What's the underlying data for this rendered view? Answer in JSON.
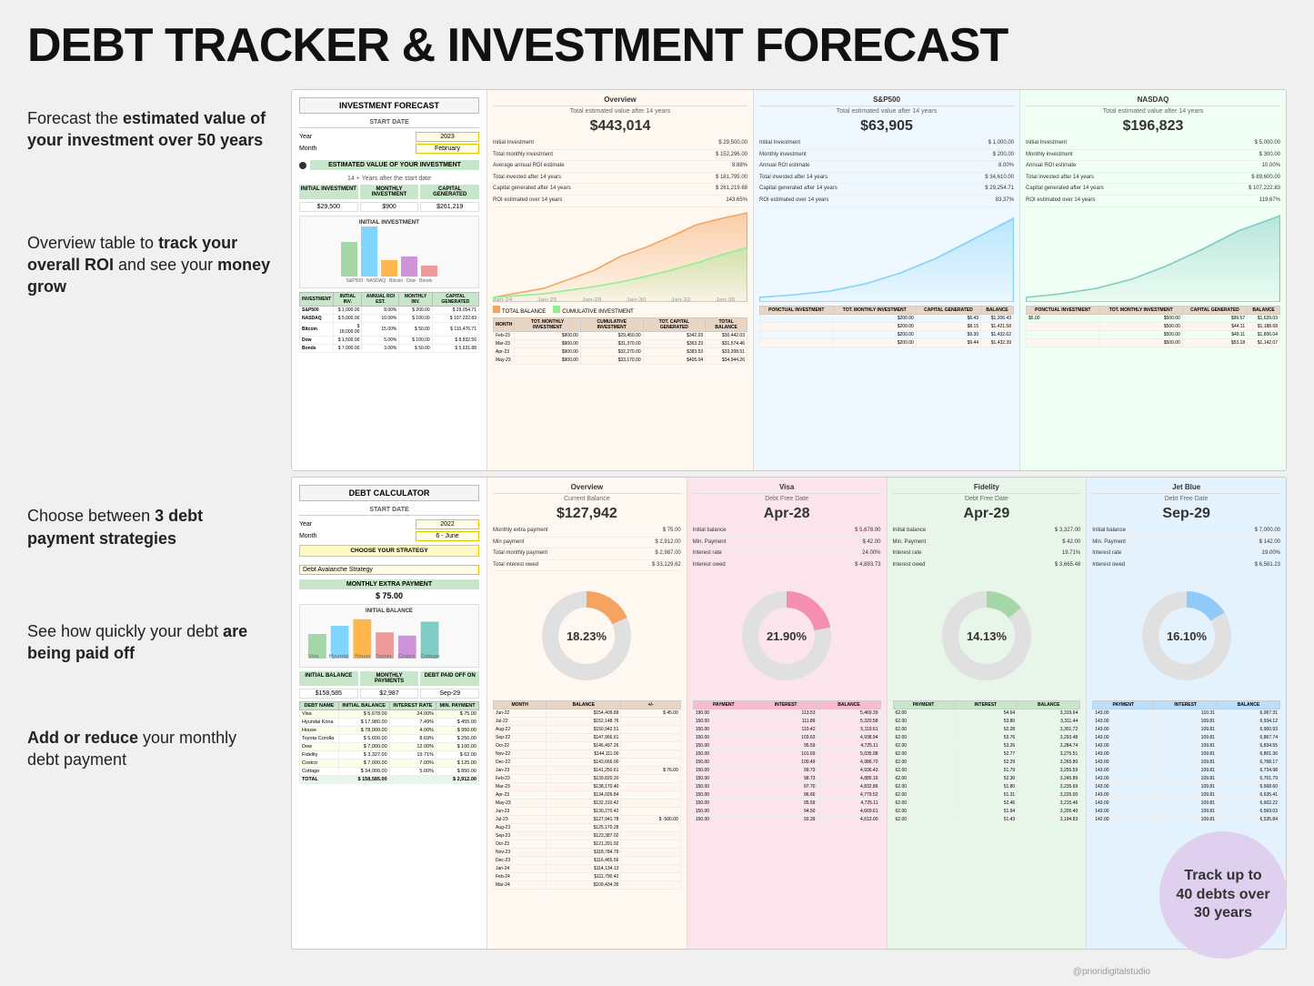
{
  "title": "DEBT TRACKER & INVESTMENT FORECAST",
  "investment": {
    "section_title": "INVESTMENT FORECAST",
    "start_date_label": "START DATE",
    "year_label": "Year",
    "month_label": "Month",
    "year_value": "2023",
    "month_value": "February",
    "estimated_label": "ESTIMATED VALUE OF YOUR INVESTMENT",
    "years_after": "14 + Years after the start date",
    "initial_investment_label": "INITIAL INVESTMENT",
    "monthly_investment_label": "MONTHLY INVESTMENT",
    "capital_generated_label": "CAPITAL GENERATED",
    "initial_value": "$29,500",
    "monthly_value": "$900",
    "capital_value": "$261,219",
    "chart_title": "INITIAL INVESTMENT",
    "chart_labels": [
      "S&P500",
      "NASDAQ",
      "Bitcoin",
      "Dow",
      "Bonds"
    ],
    "table_headers": [
      "INVESTMENT",
      "INITIAL INVESTMENT",
      "ANNUAL ROI EST.",
      "MONTHLY INVESTMENT",
      "CAPITAL GENERATED"
    ],
    "table_rows": [
      [
        "S&P500",
        "$ 1,000.00",
        "8.00%",
        "$ 200.00",
        "$ 29,054.71"
      ],
      [
        "NASDAQ",
        "$ 5,000.00",
        "10.00%",
        "$ 100.00",
        "$ 107,222.83"
      ],
      [
        "Bitcoin",
        "$ 18,000.00",
        "15.00%",
        "$ 50.00",
        "$ 110,476.71"
      ],
      [
        "Dow",
        "$ 1,500.00",
        "5.00%",
        "$ 100.00",
        "$ 8,832.56"
      ],
      [
        "Bonds",
        "$ 7,000.00",
        "3.00%",
        "$ 50.00",
        "$ 5,631.88"
      ]
    ]
  },
  "overview_inv": {
    "title": "Overview",
    "subtitle": "Total estimated value after 14 years",
    "big_value": "$443,014",
    "stats": [
      [
        "Initial Investment",
        "$ 29,500.00"
      ],
      [
        "Total monthly investment",
        "$ 152,296.00"
      ],
      [
        "Average annual ROI estimate",
        "8.88%"
      ],
      [
        "Total invested after 14 years",
        "$ 181,795.00"
      ],
      [
        "Capital generated after 14 years",
        "$ 261,219.68"
      ],
      [
        "ROI estimated over 14 years",
        "143.65%"
      ]
    ],
    "chart_labels": [
      "Jan-24",
      "Jan-25",
      "Jan-28",
      "Jan-30",
      "Jan-32",
      "Jan-35"
    ],
    "legend": [
      "TOTAL BALANCE",
      "CUMULATIVE INVESTMENT"
    ],
    "table_headers": [
      "MONTH",
      "TOT. MONTHLY INVESTMENT",
      "CUMULATIVE INVESTMENT",
      "TOT. CAPITAL GENERATED",
      "TOTAL BALANCE"
    ],
    "table_rows": [
      [
        "Feb-23",
        "$900.00",
        "$29,450.00",
        "$342.03",
        "$30,442.03"
      ],
      [
        "Mar-23",
        "$900.00",
        "$31,370.00",
        "$363.23",
        "$31,574.46"
      ],
      [
        "Apr-23",
        "$900.00",
        "$32,270.00",
        "$383.53",
        "$33,208.51"
      ],
      [
        "May-23",
        "$900.00",
        "$33,170.00",
        "$405.04",
        "$34,944.26"
      ]
    ]
  },
  "sp500": {
    "title": "S&P500",
    "subtitle": "Total estimated value after 14 years",
    "big_value": "$63,905",
    "stats": [
      [
        "Initial Investment",
        "$ 1,000.00"
      ],
      [
        "Monthly investment",
        "$ 200.00"
      ],
      [
        "Annual ROI estimate",
        "8.00%"
      ],
      [
        "Total invested after 14 years",
        "$ 34,610.00"
      ],
      [
        "Capital generated after 14 years",
        "$ 29,254.71"
      ],
      [
        "ROI estimated over 14 years",
        "83.37%"
      ]
    ],
    "table_headers": [
      "PONCTUAL INVESTMENT",
      "TOT. MONTHLY INVESTMENT",
      "CAPITAL GENERATED",
      "BALANCE"
    ],
    "table_rows": [
      [
        "",
        "$200.00",
        "$6.43",
        "$1,206.43"
      ],
      [
        "",
        "$200.00",
        "$8.15",
        "$1,421.58"
      ],
      [
        "",
        "$200.00",
        "$9.30",
        "$1,432.62"
      ],
      [
        "",
        "$200.00",
        "$9.44",
        "$1,432.39"
      ]
    ]
  },
  "nasdaq": {
    "title": "NASDAQ",
    "subtitle": "Total estimated value after 14 years",
    "big_value": "$196,823",
    "stats": [
      [
        "Initial Investment",
        "$ 5,000.00"
      ],
      [
        "Monthly investment",
        "$ 300.00"
      ],
      [
        "Annual ROI estimate",
        "10.00%"
      ],
      [
        "Total invested after 14 years",
        "$ 89,600.00"
      ],
      [
        "Capital generated after 14 years",
        "$ 107,222.83"
      ],
      [
        "ROI estimated over 14 years",
        "119.67%"
      ]
    ],
    "table_headers": [
      "PONCTUAL INVESTMENT",
      "TOT. MONTHLY INVESTMENT",
      "CAPITAL GENERATED",
      "BALANCE"
    ],
    "table_rows": [
      [
        "$5.00",
        "$500.00",
        "$99.57",
        "$1,639.03"
      ],
      [
        "",
        "$500.00",
        "$44.11",
        "$1,188.68"
      ],
      [
        "",
        "$500.00",
        "$49.11",
        "$1,806.04"
      ],
      [
        "",
        "$500.00",
        "$53.18",
        "$1,142.07"
      ]
    ]
  },
  "debt": {
    "section_title": "DEBT CALCULATOR",
    "start_date_label": "START DATE",
    "year_label": "Year",
    "month_label": "Month",
    "year_value": "2022",
    "month_value": "6 - June",
    "strategy_label": "CHOOSE YOUR STRATEGY",
    "strategy_value": "Debt Avalanche Strategy",
    "extra_payment_label": "MONTHLY EXTRA PAYMENT",
    "extra_payment_value": "$ 75.00",
    "chart_title": "INITIAL BALANCE",
    "chart_labels": [
      "Visa",
      "Hyundai",
      "House",
      "Toyota",
      "Costco",
      "Cottage"
    ],
    "summary_labels": [
      "INITIAL BALANCE",
      "MONTHLY PAYMENTS",
      "DEBT PAID OFF ON"
    ],
    "summary_values": [
      "$158,585",
      "$2,987",
      "Sep-29"
    ],
    "table_headers": [
      "DEBT NAME",
      "INITIAL BALANCE",
      "INTEREST RATE",
      "MIN. PAYMENT"
    ],
    "table_rows": [
      [
        "Visa",
        "$ 5,678.00",
        "24.00%",
        "$ 75.00"
      ],
      [
        "Hyundai Kona",
        "$ 17,980.00",
        "7.49%",
        "$ 455.00"
      ],
      [
        "House",
        "$ 78,000.00",
        "4.00%",
        "$ 950.00"
      ],
      [
        "Toyota Corolla",
        "$ 5,600.00",
        "8.69%",
        "$ 250.00"
      ],
      [
        "Dow",
        "$ 7,000.00",
        "12.00%",
        "$ 100.00"
      ],
      [
        "Fidelity",
        "$ 3,327.00",
        "19.71%",
        "$ 62.00"
      ],
      [
        "Costco",
        "$ 7,000.00",
        "7.00%",
        "$ 125.00"
      ],
      [
        "Cottage",
        "$ 34,000.00",
        "5.00%",
        "$ 850.00"
      ]
    ],
    "total_row": [
      "TOTAL",
      "$ 158,585.00",
      "",
      "$ 2,912.00"
    ]
  },
  "overview_debt": {
    "title": "Overview",
    "subtitle": "Current Balance",
    "big_value": "$127,942",
    "stats": [
      [
        "Monthly extra payment",
        "$ 75.00"
      ],
      [
        "Min payment",
        "$ 2,912.00"
      ],
      [
        "Total monthly payment",
        "$ 2,987.00"
      ],
      [
        "Total interest owed",
        "$ 33,129.62"
      ]
    ],
    "donut_percent": "18.23%",
    "table_headers": [
      "MONTH",
      "BALANCE",
      "+/-"
    ],
    "table_rows": [
      [
        "Jun-22",
        "$154,409.89",
        "$ 45.00"
      ],
      [
        "Jul-22",
        "$152,148.76",
        ""
      ],
      [
        "Aug-22",
        "$150,942.51",
        ""
      ],
      [
        "Sep-22",
        "$147,966.61",
        ""
      ],
      [
        "Oct-22",
        "$146,497.26",
        ""
      ],
      [
        "Nov-22",
        "$144,111.00",
        ""
      ],
      [
        "Dec-22",
        "$143,666.00",
        ""
      ],
      [
        "Jan-23",
        "$141,250.61",
        "$ 76.00"
      ],
      [
        "Feb-23",
        "$139,820.20",
        ""
      ],
      [
        "Mar-23",
        "$138,170.40",
        ""
      ],
      [
        "Apr-23",
        "$134,026.84",
        ""
      ],
      [
        "May-23",
        "$132,310.42",
        ""
      ],
      [
        "Jun-23",
        "$130,270.42",
        ""
      ],
      [
        "Jul-23",
        "$127,941.78",
        "$ -500.00"
      ],
      [
        "Aug-23",
        "$125,170.28",
        ""
      ],
      [
        "Sep-23",
        "$123,387.02",
        ""
      ],
      [
        "Oct-23",
        "$121,291.92",
        ""
      ],
      [
        "Nov-23",
        "$118,784.79",
        ""
      ],
      [
        "Dec-23",
        "$116,465.56",
        ""
      ],
      [
        "Jan-24",
        "$114,134.13",
        ""
      ],
      [
        "Feb-24",
        "$111,790.42",
        ""
      ],
      [
        "Mar-24",
        "$109,434.35",
        ""
      ]
    ]
  },
  "visa_debt": {
    "title": "Visa",
    "subtitle": "Debt Free Date",
    "free_date": "Apr-28",
    "stats": [
      [
        "Initial balance",
        "$ 5,678.00"
      ],
      [
        "Min. Payment",
        "$ 42.00"
      ],
      [
        "Interest rate",
        "24.00%"
      ],
      [
        "Interest owed",
        "$ 4,893.73"
      ]
    ],
    "donut_percent": "21.90%",
    "table_headers": [
      "PAYMENT",
      "INTEREST",
      "BALANCE"
    ],
    "table_rows": [
      [
        "190.00",
        "113.53",
        "5,469.39"
      ],
      [
        "150.00",
        "111.89",
        "5,320.58"
      ],
      [
        "150.00",
        "110.42",
        "5,119.61"
      ],
      [
        "150.00",
        "103.63",
        "4,938.94"
      ],
      [
        "150.00",
        "95.59",
        "4,725.11"
      ],
      [
        "150.00",
        "101.69",
        "5,035.98"
      ],
      [
        "150.00",
        "100.49",
        "4,986.70"
      ],
      [
        "150.00",
        "99.73",
        "4,936.43"
      ],
      [
        "150.00",
        "98.73",
        "4,885.16"
      ],
      [
        "150.00",
        "97.70",
        "4,832.86"
      ],
      [
        "150.00",
        "96.66",
        "4,779.52"
      ],
      [
        "150.00",
        "95.59",
        "4,725.11"
      ],
      [
        "150.00",
        "94.50",
        "4,669.61"
      ],
      [
        "150.00",
        "93.39",
        "4,613.00"
      ]
    ]
  },
  "fidelity_debt": {
    "title": "Fidelity",
    "subtitle": "Debt Free Date",
    "free_date": "Apr-29",
    "stats": [
      [
        "Initial balance",
        "$ 3,327.00"
      ],
      [
        "Min. Payment",
        "$ 42.00"
      ],
      [
        "Interest rate",
        "19.71%"
      ],
      [
        "Interest owed",
        "$ 3,665.48"
      ]
    ],
    "donut_percent": "14.13%",
    "table_headers": [
      "PAYMENT",
      "INTEREST",
      "BALANCE"
    ],
    "table_rows": [
      [
        "62.00",
        "54.64",
        "3,319.64"
      ],
      [
        "62.00",
        "53.80",
        "3,311.44"
      ],
      [
        "62.00",
        "52.28",
        "3,301.72"
      ],
      [
        "62.00",
        "53.76",
        "3,293.48"
      ],
      [
        "62.00",
        "53.26",
        "3,284.74"
      ],
      [
        "62.00",
        "52.77",
        "3,275.51"
      ],
      [
        "62.00",
        "52.29",
        "3,265.80"
      ],
      [
        "62.00",
        "51.79",
        "3,255.59"
      ],
      [
        "62.00",
        "52.30",
        "3,245.89"
      ],
      [
        "62.00",
        "51.80",
        "3,235.69"
      ],
      [
        "62.00",
        "51.31",
        "3,225.00"
      ],
      [
        "62.00",
        "52.46",
        "3,215.46"
      ],
      [
        "62.00",
        "51.94",
        "3,205.40"
      ],
      [
        "62.00",
        "51.43",
        "3,194.83"
      ]
    ]
  },
  "jetblue_debt": {
    "title": "Jet Blue",
    "subtitle": "Debt Free Date",
    "free_date": "Sep-29",
    "stats": [
      [
        "Initial balance",
        "$ 7,000.00"
      ],
      [
        "Min. Payment",
        "$ 142.00"
      ],
      [
        "Interest rate",
        "19.00%"
      ],
      [
        "Interest owed",
        "$ 6,581.23"
      ]
    ],
    "donut_percent": "16.10%",
    "table_headers": [
      "PAYMENT",
      "INTEREST",
      "BALANCE"
    ],
    "table_rows": [
      [
        "143.00",
        "110.31",
        "6,967.31"
      ],
      [
        "143.00",
        "109.81",
        "6,934.12"
      ],
      [
        "143.00",
        "109.81",
        "6,900.93"
      ],
      [
        "143.00",
        "109.81",
        "6,867.74"
      ],
      [
        "143.00",
        "109.81",
        "6,834.55"
      ],
      [
        "143.00",
        "109.81",
        "6,801.36"
      ],
      [
        "143.00",
        "109.81",
        "6,768.17"
      ],
      [
        "143.00",
        "109.81",
        "6,734.98"
      ],
      [
        "143.00",
        "109.81",
        "6,701.79"
      ],
      [
        "143.00",
        "109.81",
        "6,668.60"
      ],
      [
        "143.00",
        "109.81",
        "6,635.41"
      ],
      [
        "143.00",
        "109.81",
        "6,602.22"
      ],
      [
        "143.00",
        "109.81",
        "6,569.03"
      ],
      [
        "$",
        "142.00",
        "6,535.84"
      ]
    ]
  },
  "track_badge": {
    "line1": "Track up to",
    "line2": "40 debts over",
    "line3": "30 years"
  },
  "watermark": "@prioridigitalstudio",
  "annotations": {
    "ann1": "Forecast the estimated value of your investment over 50 years",
    "ann2": "Overview table to track your overall ROI and see your money grow",
    "ann3": "Choose between 3 debt payment strategies",
    "ann4": "See how quickly your debt are being paid off",
    "ann5": "Add or reduce your monthly debt payment"
  }
}
